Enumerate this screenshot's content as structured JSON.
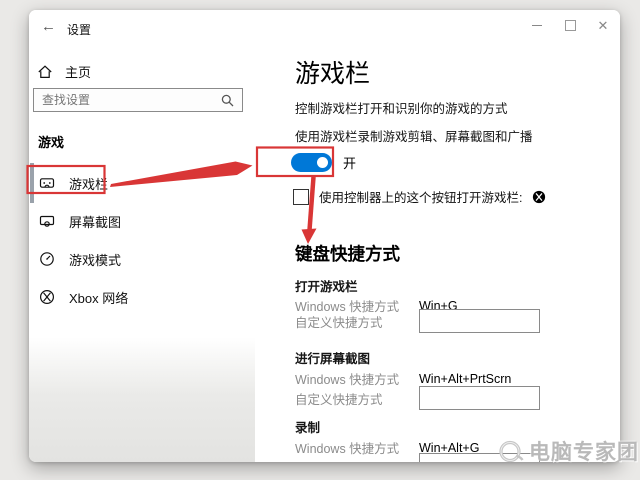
{
  "titlebar": {
    "title": "设置"
  },
  "sidebar": {
    "home_label": "主页",
    "search_placeholder": "查找设置",
    "group_header": "游戏",
    "items": [
      {
        "label": "游戏栏",
        "icon": "game-bar-icon",
        "selected": true
      },
      {
        "label": "屏幕截图",
        "icon": "captures-icon",
        "selected": false
      },
      {
        "label": "游戏模式",
        "icon": "game-mode-icon",
        "selected": false
      },
      {
        "label": "Xbox 网络",
        "icon": "xbox-icon",
        "selected": false
      }
    ]
  },
  "main": {
    "title": "游戏栏",
    "description": "控制游戏栏打开和识别你的游戏的方式",
    "toggle_label": "使用游戏栏录制游戏剪辑、屏幕截图和广播",
    "toggle_state": "开",
    "toggle_on": true,
    "checkbox_label": "使用控制器上的这个按钮打开游戏栏:",
    "checkbox_checked": false,
    "shortcuts_title": "键盘快捷方式",
    "shortcut_groups": [
      {
        "name": "打开游戏栏",
        "windows_label": "Windows 快捷方式",
        "windows_value": "Win+G",
        "custom_label": "自定义快捷方式",
        "custom_value": ""
      },
      {
        "name": "进行屏幕截图",
        "windows_label": "Windows 快捷方式",
        "windows_value": "Win+Alt+PrtScrn",
        "custom_label": "自定义快捷方式",
        "custom_value": ""
      },
      {
        "name": "录制",
        "windows_label": "Windows 快捷方式",
        "windows_value": "Win+Alt+G",
        "custom_label": "",
        "custom_value": ""
      }
    ]
  },
  "watermark": {
    "text": "电脑专家团"
  },
  "colors": {
    "accent": "#0078d7",
    "annotation_red": "#d93636",
    "window_bg": "#ffffff",
    "page_bg": "#eae9e7"
  }
}
